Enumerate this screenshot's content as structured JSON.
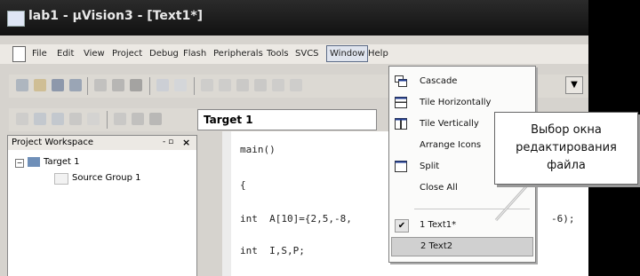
{
  "window": {
    "title": "lab1 - µVision3 - [Text1*]"
  },
  "menubar": {
    "items": [
      "File",
      "Edit",
      "View",
      "Project",
      "Debug",
      "Flash",
      "Peripherals",
      "Tools",
      "SVCS",
      "Window",
      "Help"
    ],
    "active": "Window"
  },
  "toolbar": {
    "target_label": "Target 1"
  },
  "workspace": {
    "title": "Project Workspace",
    "pin": "- ▫",
    "close": "×",
    "tree": [
      {
        "label": "Target 1",
        "expand": "−"
      },
      {
        "label": "Source Group 1"
      }
    ]
  },
  "editor": {
    "lines": [
      "main()",
      "{",
      "int  A[10]={2,5,-8,",
      "int  I,S,P;"
    ],
    "tail": "-6);"
  },
  "window_menu": {
    "items": [
      {
        "label": "Cascade",
        "icon": "cascade-icon"
      },
      {
        "label": "Tile Horizontally",
        "icon": "tile-horizontal-icon"
      },
      {
        "label": "Tile Vertically",
        "icon": "tile-vertical-icon"
      },
      {
        "label": "Arrange Icons",
        "icon": ""
      },
      {
        "label": "Split",
        "icon": "split-window-icon"
      },
      {
        "label": "Close All",
        "icon": ""
      },
      {
        "label": "1 Text1*",
        "icon": "checkmark-icon",
        "checked": true
      },
      {
        "label": "2 Text2",
        "icon": "",
        "highlighted": true
      }
    ]
  },
  "callout": {
    "lines": [
      "Выбор окна",
      "редактирования",
      "файла"
    ]
  },
  "colors": {
    "titlebar": "#1c1c1c",
    "chrome": "#d6d3ce",
    "menu_bg": "#fbfbfa",
    "highlight": "#d0d0d0"
  }
}
